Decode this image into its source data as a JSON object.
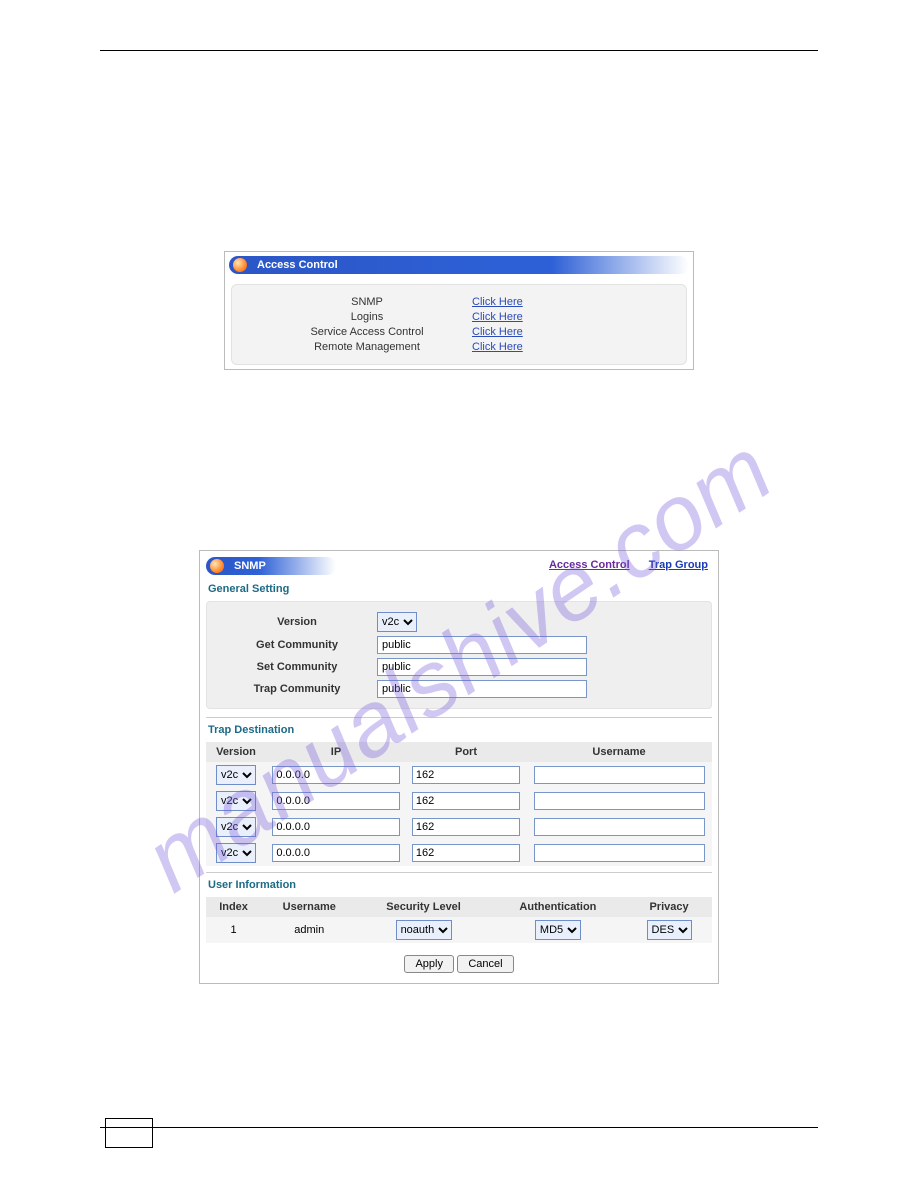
{
  "watermark": "manualshive.com",
  "accessControl": {
    "title": "Access Control",
    "rows": [
      {
        "label": "SNMP",
        "link": "Click Here"
      },
      {
        "label": "Logins",
        "link": "Click Here"
      },
      {
        "label": "Service Access Control",
        "link": "Click Here"
      },
      {
        "label": "Remote Management",
        "link": "Click Here"
      }
    ]
  },
  "snmp": {
    "title": "SNMP",
    "links": {
      "accessControl": "Access Control",
      "trapGroup": "Trap Group"
    },
    "general": {
      "title": "General Setting",
      "version_label": "Version",
      "version": "v2c",
      "get_label": "Get Community",
      "get": "public",
      "set_label": "Set Community",
      "set": "public",
      "trap_label": "Trap Community",
      "trap": "public"
    },
    "trapDest": {
      "title": "Trap Destination",
      "headers": {
        "version": "Version",
        "ip": "IP",
        "port": "Port",
        "username": "Username"
      },
      "rows": [
        {
          "version": "v2c",
          "ip": "0.0.0.0",
          "port": "162",
          "username": ""
        },
        {
          "version": "v2c",
          "ip": "0.0.0.0",
          "port": "162",
          "username": ""
        },
        {
          "version": "v2c",
          "ip": "0.0.0.0",
          "port": "162",
          "username": ""
        },
        {
          "version": "v2c",
          "ip": "0.0.0.0",
          "port": "162",
          "username": ""
        }
      ]
    },
    "userInfo": {
      "title": "User Information",
      "headers": {
        "index": "Index",
        "username": "Username",
        "security": "Security Level",
        "auth": "Authentication",
        "privacy": "Privacy"
      },
      "row": {
        "index": "1",
        "username": "admin",
        "security": "noauth",
        "auth": "MD5",
        "privacy": "DES"
      }
    },
    "buttons": {
      "apply": "Apply",
      "cancel": "Cancel"
    }
  }
}
